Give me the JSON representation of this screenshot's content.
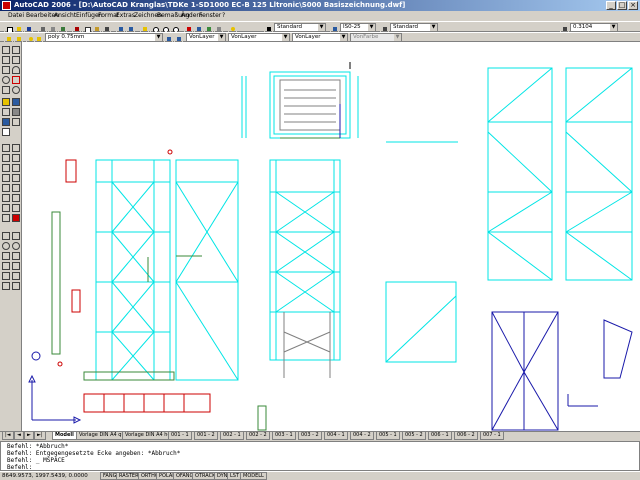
{
  "window": {
    "title": "AutoCAD 2006 - [D:\\AutoCAD Kranglas\\TDKe 1-SD1000 EC-B 125 Lltronic\\S000 Basiszeichnung.dwf]",
    "minimize": "_",
    "restore": "□",
    "close": "×"
  },
  "menu": [
    "Datei",
    "Bearbeiten",
    "Ansicht",
    "Einfügen",
    "Format",
    "Extras",
    "Zeichnen",
    "Bemaßung",
    "Ändern",
    "Fenster",
    "?"
  ],
  "toolbar2": {
    "text_style": "Standard",
    "dim_style": "IS0-25",
    "table_style": "Standard",
    "scale_value": "0.3104"
  },
  "toolbar3": {
    "layer": "poly 0.75mm",
    "color": "VonLayer",
    "linetype": "VonLayer",
    "lineweight": "VonLayer",
    "plotstyle": "VonFarbe"
  },
  "tabs": {
    "nav": [
      "|◄",
      "◄",
      "►",
      "►|"
    ],
    "items": [
      "Modell",
      "Vorlage DIN A4 quer",
      "Vorlage DIN A4 hoch",
      "001 - 1",
      "001 - 2",
      "002 - 1",
      "002 - 2",
      "003 - 1",
      "003 - 2",
      "004 - 1",
      "004 - 2",
      "005 - 1",
      "005 - 2",
      "006 - 1",
      "006 - 2",
      "007 - 1"
    ]
  },
  "command": {
    "lines": [
      "Befehl: *Abbruch*",
      "Befehl:  Entgegengesetzte Ecke angeben: *Abbruch*",
      "Befehl: _ MSPACE",
      "Befehl:"
    ]
  },
  "status": {
    "coords": "8649.9573, 1997.5439, 0.0000",
    "buttons": [
      "FANG",
      "RASTER",
      "ORTHO",
      "POLAR",
      "OFANG",
      "OTRACK",
      "DYN",
      "LST",
      "MODELL"
    ]
  },
  "colors": {
    "cyan": "#00e5e5",
    "blue": "#1a1aaa",
    "red": "#cc0000",
    "green": "#3a8a3a",
    "gray": "#808080",
    "title_bar": "#0a246a"
  },
  "icons": {
    "left_toolbar": [
      "line-icon",
      "xline-icon",
      "polyline-icon",
      "polygon-icon",
      "rectangle-icon",
      "arc-icon",
      "circle-icon",
      "revcloud-icon",
      "spline-icon",
      "ellipse-icon",
      "insert-block-icon",
      "make-block-icon",
      "point-icon",
      "hatch-icon",
      "region-icon",
      "table-icon",
      "mtext-icon"
    ],
    "ucs": "ucs-icon"
  }
}
